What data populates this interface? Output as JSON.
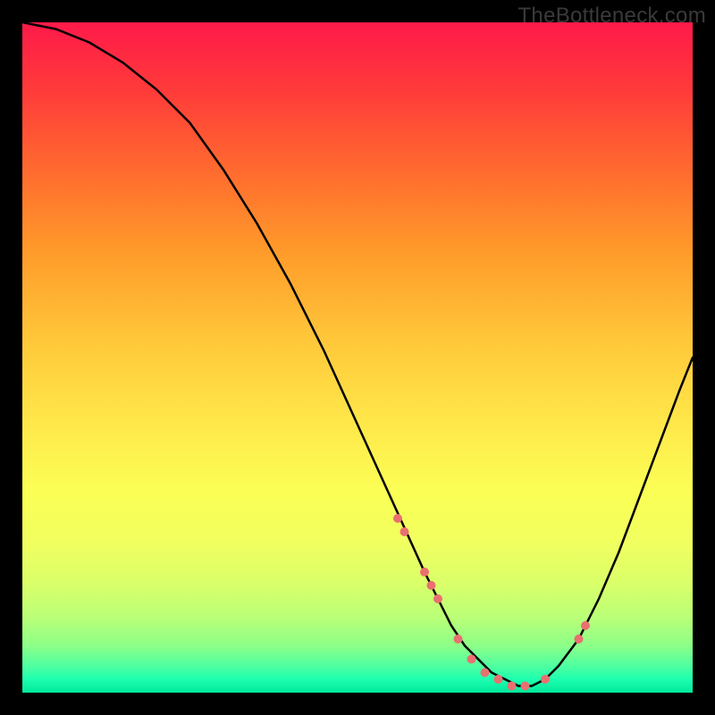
{
  "watermark": "TheBottleneck.com",
  "colors": {
    "background": "#000000",
    "gradient_top": "#ff1a4a",
    "gradient_bottom": "#00e89a",
    "curve": "#000000",
    "dots": "#e97070"
  },
  "chart_data": {
    "type": "line",
    "title": "",
    "xlabel": "",
    "ylabel": "",
    "xlim": [
      0,
      100
    ],
    "ylim": [
      0,
      100
    ],
    "grid": false,
    "series": [
      {
        "name": "bottleneck-curve",
        "x": [
          0,
          5,
          10,
          15,
          20,
          25,
          30,
          35,
          40,
          45,
          50,
          55,
          60,
          62,
          64,
          66,
          68,
          70,
          72,
          74,
          76,
          78,
          80,
          83,
          86,
          89,
          92,
          95,
          98,
          100
        ],
        "values": [
          100,
          99,
          97,
          94,
          90,
          85,
          78,
          70,
          61,
          51,
          40,
          29,
          18,
          14,
          10,
          7,
          5,
          3,
          2,
          1,
          1,
          2,
          4,
          8,
          14,
          21,
          29,
          37,
          45,
          50
        ]
      }
    ],
    "markers": {
      "name": "highlight-dots",
      "x": [
        56,
        57,
        60,
        61,
        62,
        65,
        67,
        69,
        71,
        73,
        75,
        78,
        83,
        84
      ],
      "values": [
        26,
        24,
        18,
        16,
        14,
        8,
        5,
        3,
        2,
        1,
        1,
        2,
        8,
        10
      ],
      "size": [
        10,
        10,
        10,
        10,
        10,
        10,
        10,
        10,
        10,
        10,
        10,
        10,
        10,
        10
      ]
    }
  }
}
